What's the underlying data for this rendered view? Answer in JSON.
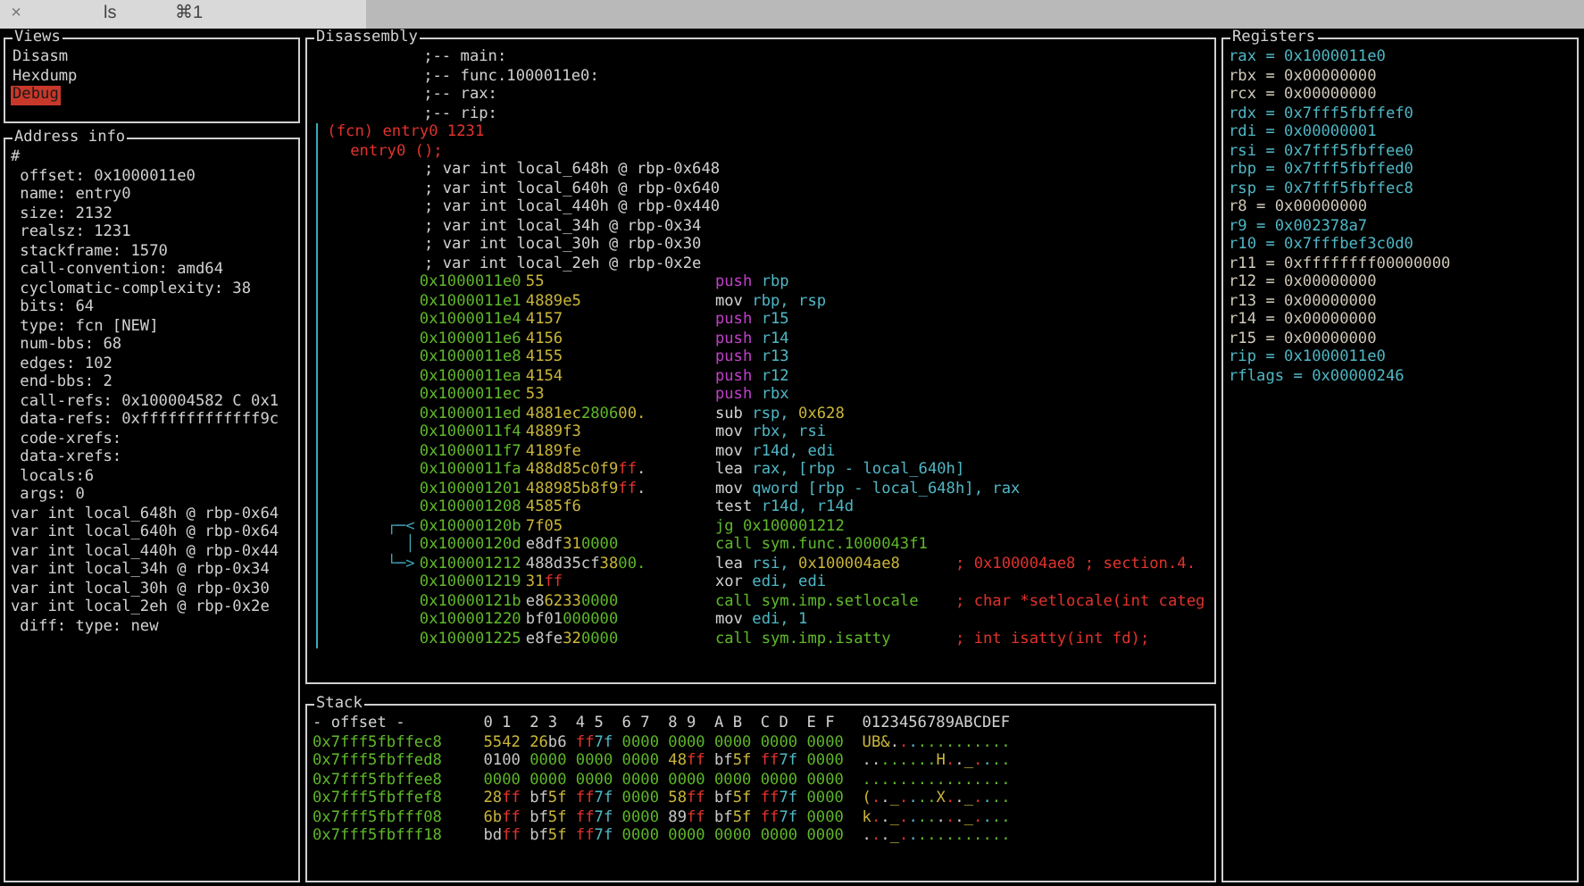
{
  "tab": {
    "close": "×",
    "title": "ls",
    "shortcut": "⌘1"
  },
  "views": {
    "title": "Views",
    "items": [
      {
        "label": "Disasm",
        "selected": false
      },
      {
        "label": "Hexdump",
        "selected": false
      },
      {
        "label": "Debug",
        "selected": true
      }
    ]
  },
  "address_info": {
    "title": "Address info",
    "lines": [
      {
        "text": "#",
        "indented": false
      },
      {
        "text": "offset: 0x1000011e0",
        "indented": true
      },
      {
        "text": "name: entry0",
        "indented": true
      },
      {
        "text": "size: 2132",
        "indented": true
      },
      {
        "text": "realsz: 1231",
        "indented": true
      },
      {
        "text": "stackframe: 1570",
        "indented": true
      },
      {
        "text": "call-convention: amd64",
        "indented": true
      },
      {
        "text": "cyclomatic-complexity: 38",
        "indented": true
      },
      {
        "text": "bits: 64",
        "indented": true
      },
      {
        "text": "type: fcn [NEW]",
        "indented": true
      },
      {
        "text": "num-bbs: 68",
        "indented": true
      },
      {
        "text": "edges: 102",
        "indented": true
      },
      {
        "text": "end-bbs: 2",
        "indented": true
      },
      {
        "text": "call-refs: 0x100004582 C 0x1",
        "indented": true
      },
      {
        "text": "data-refs: 0xfffffffffffff9c",
        "indented": true
      },
      {
        "text": "code-xrefs:",
        "indented": true
      },
      {
        "text": "data-xrefs:",
        "indented": true
      },
      {
        "text": "locals:6",
        "indented": true
      },
      {
        "text": "args: 0",
        "indented": true
      },
      {
        "text": "var int local_648h @ rbp-0x64",
        "indented": false
      },
      {
        "text": "var int local_640h @ rbp-0x64",
        "indented": false
      },
      {
        "text": "var int local_440h @ rbp-0x44",
        "indented": false
      },
      {
        "text": "var int local_34h @ rbp-0x34",
        "indented": false
      },
      {
        "text": "var int local_30h @ rbp-0x30",
        "indented": false
      },
      {
        "text": "var int local_2eh @ rbp-0x2e",
        "indented": false
      },
      {
        "text": "diff: type: new",
        "indented": true
      }
    ]
  },
  "disassembly": {
    "title": "Disassembly",
    "flags": [
      ";-- main:",
      ";-- func.1000011e0:",
      ";-- rax:",
      ";-- rip:"
    ],
    "function_header": "(fcn) entry0 1231",
    "function_signature": "entry0 ();",
    "vars": [
      "; var int local_648h @ rbp-0x648",
      "; var int local_640h @ rbp-0x640",
      "; var int local_440h @ rbp-0x440",
      "; var int local_34h @ rbp-0x34",
      "; var int local_30h @ rbp-0x30",
      "; var int local_2eh @ rbp-0x2e"
    ],
    "instructions": [
      {
        "address": "0x1000011e0",
        "bytes": [
          {
            "text": "55",
            "kind": "printable"
          }
        ],
        "mnemonic": "push",
        "kind": "stack",
        "operands": [
          {
            "text": "rbp",
            "kind": "reg"
          }
        ]
      },
      {
        "address": "0x1000011e1",
        "bytes": [
          {
            "text": "4889e5",
            "kind": "printable"
          }
        ],
        "mnemonic": "mov",
        "kind": "data",
        "operands": [
          {
            "text": "rbp, rsp",
            "kind": "reg"
          }
        ]
      },
      {
        "address": "0x1000011e4",
        "bytes": [
          {
            "text": "4157",
            "kind": "printable"
          }
        ],
        "mnemonic": "push",
        "kind": "stack",
        "operands": [
          {
            "text": "r15",
            "kind": "reg"
          }
        ]
      },
      {
        "address": "0x1000011e6",
        "bytes": [
          {
            "text": "4156",
            "kind": "printable"
          }
        ],
        "mnemonic": "push",
        "kind": "stack",
        "operands": [
          {
            "text": "r14",
            "kind": "reg"
          }
        ]
      },
      {
        "address": "0x1000011e8",
        "bytes": [
          {
            "text": "4155",
            "kind": "printable"
          }
        ],
        "mnemonic": "push",
        "kind": "stack",
        "operands": [
          {
            "text": "r13",
            "kind": "reg"
          }
        ]
      },
      {
        "address": "0x1000011ea",
        "bytes": [
          {
            "text": "4154",
            "kind": "printable"
          }
        ],
        "mnemonic": "push",
        "kind": "stack",
        "operands": [
          {
            "text": "r12",
            "kind": "reg"
          }
        ]
      },
      {
        "address": "0x1000011ec",
        "bytes": [
          {
            "text": "53",
            "kind": "printable"
          }
        ],
        "mnemonic": "push",
        "kind": "stack",
        "operands": [
          {
            "text": "rbx",
            "kind": "reg"
          }
        ]
      },
      {
        "address": "0x1000011ed",
        "bytes": [
          {
            "text": "4881ec",
            "kind": "printable"
          },
          {
            "text": "2806",
            "kind": "zero"
          },
          {
            "text": "00.",
            "kind": "printable"
          }
        ],
        "mnemonic": "sub",
        "kind": "data",
        "operands": [
          {
            "text": "rsp, ",
            "kind": "reg"
          },
          {
            "text": "0x628",
            "kind": "imm"
          }
        ]
      },
      {
        "address": "0x1000011f4",
        "bytes": [
          {
            "text": "4889f3",
            "kind": "printable"
          }
        ],
        "mnemonic": "mov",
        "kind": "data",
        "operands": [
          {
            "text": "rbx, rsi",
            "kind": "reg"
          }
        ]
      },
      {
        "address": "0x1000011f7",
        "bytes": [
          {
            "text": "4189fe",
            "kind": "printable"
          }
        ],
        "mnemonic": "mov",
        "kind": "data",
        "operands": [
          {
            "text": "r14d, edi",
            "kind": "reg"
          }
        ]
      },
      {
        "address": "0x1000011fa",
        "bytes": [
          {
            "text": "488d85c0f9",
            "kind": "printable"
          },
          {
            "text": "ff",
            "kind": "ff"
          },
          {
            "text": ".",
            "kind": "other"
          }
        ],
        "mnemonic": "lea",
        "kind": "data",
        "operands": [
          {
            "text": "rax, [rbp - local_640h]",
            "kind": "reg"
          }
        ]
      },
      {
        "address": "0x100001201",
        "bytes": [
          {
            "text": "488985b8f9",
            "kind": "printable"
          },
          {
            "text": "ff",
            "kind": "ff"
          },
          {
            "text": ".",
            "kind": "other"
          }
        ],
        "mnemonic": "mov",
        "kind": "data",
        "operands": [
          {
            "text": "qword [rbp - local_648h], rax",
            "kind": "reg"
          }
        ]
      },
      {
        "address": "0x100001208",
        "bytes": [
          {
            "text": "4585f6",
            "kind": "printable"
          }
        ],
        "mnemonic": "test",
        "kind": "data",
        "operands": [
          {
            "text": "r14d, r14d",
            "kind": "reg"
          }
        ]
      },
      {
        "address": "0x10000120b",
        "jump": "┌─<",
        "bytes": [
          {
            "text": "7f05",
            "kind": "printable"
          }
        ],
        "mnemonic": "jg",
        "kind": "flow",
        "operands": [
          {
            "text": "0x100001212",
            "kind": "target"
          }
        ]
      },
      {
        "address": "0x10000120d",
        "jump": "│",
        "bytes": [
          {
            "text": "e8df",
            "kind": "other"
          },
          {
            "text": "31",
            "kind": "printable"
          },
          {
            "text": "0000",
            "kind": "zero"
          }
        ],
        "mnemonic": "call",
        "kind": "flow",
        "operands": [
          {
            "text": "sym.func.1000043f1",
            "kind": "target"
          }
        ]
      },
      {
        "address": "0x100001212",
        "jump": "└─>",
        "bytes": [
          {
            "text": "488d35cf",
            "kind": "other"
          },
          {
            "text": "38",
            "kind": "printable"
          },
          {
            "text": "00.",
            "kind": "zero"
          }
        ],
        "mnemonic": "lea",
        "kind": "data",
        "operands": [
          {
            "text": "rsi, ",
            "kind": "reg"
          },
          {
            "text": "0x100004ae8",
            "kind": "imm"
          }
        ],
        "comment": "; 0x100004ae8 ; section.4."
      },
      {
        "address": "0x100001219",
        "bytes": [
          {
            "text": "31",
            "kind": "printable"
          },
          {
            "text": "ff",
            "kind": "ff"
          }
        ],
        "mnemonic": "xor",
        "kind": "data",
        "operands": [
          {
            "text": "edi, edi",
            "kind": "reg"
          }
        ]
      },
      {
        "address": "0x10000121b",
        "bytes": [
          {
            "text": "e8",
            "kind": "other"
          },
          {
            "text": "6233",
            "kind": "printable"
          },
          {
            "text": "0000",
            "kind": "zero"
          }
        ],
        "mnemonic": "call",
        "kind": "flow",
        "operands": [
          {
            "text": "sym.imp.setlocale",
            "kind": "target"
          }
        ],
        "comment": "; char *setlocale(int categ"
      },
      {
        "address": "0x100001220",
        "bytes": [
          {
            "text": "bf01",
            "kind": "other"
          },
          {
            "text": "000000",
            "kind": "zero"
          }
        ],
        "mnemonic": "mov",
        "kind": "data",
        "operands": [
          {
            "text": "edi, 1",
            "kind": "reg"
          }
        ]
      },
      {
        "address": "0x100001225",
        "bytes": [
          {
            "text": "e8fe",
            "kind": "other"
          },
          {
            "text": "32",
            "kind": "printable"
          },
          {
            "text": "0000",
            "kind": "zero"
          }
        ],
        "mnemonic": "call",
        "kind": "flow",
        "operands": [
          {
            "text": "sym.imp.isatty",
            "kind": "target"
          }
        ],
        "comment": "; int isatty(int fd);"
      }
    ]
  },
  "stack": {
    "title": "Stack",
    "offset_header": "- offset -",
    "column_headers": [
      "0 1",
      "2 3",
      "4 5",
      "6 7",
      "8 9",
      "A B",
      "C D",
      "E F"
    ],
    "ascii_header": "0123456789ABCDEF",
    "rows": [
      {
        "offset": "0x7fff5fbffec8",
        "bytes": [
          {
            "text": "55",
            "kind": "printable"
          },
          {
            "text": "42",
            "kind": "printable"
          },
          {
            "text": "26",
            "kind": "printable"
          },
          {
            "text": "b6",
            "kind": "other"
          },
          {
            "text": "ff",
            "kind": "ff"
          },
          {
            "text": "7f",
            "kind": "del"
          },
          {
            "text": "00",
            "kind": "zero"
          },
          {
            "text": "00",
            "kind": "zero"
          },
          {
            "text": "00",
            "kind": "zero"
          },
          {
            "text": "00",
            "kind": "zero"
          },
          {
            "text": "00",
            "kind": "zero"
          },
          {
            "text": "00",
            "kind": "zero"
          },
          {
            "text": "00",
            "kind": "zero"
          },
          {
            "text": "00",
            "kind": "zero"
          },
          {
            "text": "00",
            "kind": "zero"
          },
          {
            "text": "00",
            "kind": "zero"
          }
        ],
        "ascii": "UB&............."
      },
      {
        "offset": "0x7fff5fbffed8",
        "bytes": [
          {
            "text": "01",
            "kind": "other"
          },
          {
            "text": "00",
            "kind": "other"
          },
          {
            "text": "00",
            "kind": "zero"
          },
          {
            "text": "00",
            "kind": "zero"
          },
          {
            "text": "00",
            "kind": "zero"
          },
          {
            "text": "00",
            "kind": "zero"
          },
          {
            "text": "00",
            "kind": "zero"
          },
          {
            "text": "00",
            "kind": "zero"
          },
          {
            "text": "48",
            "kind": "printable"
          },
          {
            "text": "ff",
            "kind": "ff"
          },
          {
            "text": "bf",
            "kind": "other"
          },
          {
            "text": "5f",
            "kind": "printable"
          },
          {
            "text": "ff",
            "kind": "ff"
          },
          {
            "text": "7f",
            "kind": "del"
          },
          {
            "text": "00",
            "kind": "zero"
          },
          {
            "text": "00",
            "kind": "zero"
          }
        ],
        "ascii": "........H.._...."
      },
      {
        "offset": "0x7fff5fbffee8",
        "bytes": [
          {
            "text": "00",
            "kind": "zero"
          },
          {
            "text": "00",
            "kind": "zero"
          },
          {
            "text": "00",
            "kind": "zero"
          },
          {
            "text": "00",
            "kind": "zero"
          },
          {
            "text": "00",
            "kind": "zero"
          },
          {
            "text": "00",
            "kind": "zero"
          },
          {
            "text": "00",
            "kind": "zero"
          },
          {
            "text": "00",
            "kind": "zero"
          },
          {
            "text": "00",
            "kind": "zero"
          },
          {
            "text": "00",
            "kind": "zero"
          },
          {
            "text": "00",
            "kind": "zero"
          },
          {
            "text": "00",
            "kind": "zero"
          },
          {
            "text": "00",
            "kind": "zero"
          },
          {
            "text": "00",
            "kind": "zero"
          },
          {
            "text": "00",
            "kind": "zero"
          },
          {
            "text": "00",
            "kind": "zero"
          }
        ],
        "ascii": "................"
      },
      {
        "offset": "0x7fff5fbffef8",
        "bytes": [
          {
            "text": "28",
            "kind": "printable"
          },
          {
            "text": "ff",
            "kind": "ff"
          },
          {
            "text": "bf",
            "kind": "other"
          },
          {
            "text": "5f",
            "kind": "printable"
          },
          {
            "text": "ff",
            "kind": "ff"
          },
          {
            "text": "7f",
            "kind": "del"
          },
          {
            "text": "00",
            "kind": "zero"
          },
          {
            "text": "00",
            "kind": "zero"
          },
          {
            "text": "58",
            "kind": "printable"
          },
          {
            "text": "ff",
            "kind": "ff"
          },
          {
            "text": "bf",
            "kind": "other"
          },
          {
            "text": "5f",
            "kind": "printable"
          },
          {
            "text": "ff",
            "kind": "ff"
          },
          {
            "text": "7f",
            "kind": "del"
          },
          {
            "text": "00",
            "kind": "zero"
          },
          {
            "text": "00",
            "kind": "zero"
          }
        ],
        "ascii": "(.._....X.._...."
      },
      {
        "offset": "0x7fff5fbfff08",
        "bytes": [
          {
            "text": "6b",
            "kind": "printable"
          },
          {
            "text": "ff",
            "kind": "ff"
          },
          {
            "text": "bf",
            "kind": "other"
          },
          {
            "text": "5f",
            "kind": "printable"
          },
          {
            "text": "ff",
            "kind": "ff"
          },
          {
            "text": "7f",
            "kind": "del"
          },
          {
            "text": "00",
            "kind": "zero"
          },
          {
            "text": "00",
            "kind": "zero"
          },
          {
            "text": "89",
            "kind": "other"
          },
          {
            "text": "ff",
            "kind": "ff"
          },
          {
            "text": "bf",
            "kind": "other"
          },
          {
            "text": "5f",
            "kind": "printable"
          },
          {
            "text": "ff",
            "kind": "ff"
          },
          {
            "text": "7f",
            "kind": "del"
          },
          {
            "text": "00",
            "kind": "zero"
          },
          {
            "text": "00",
            "kind": "zero"
          }
        ],
        "ascii": "k.._......._...."
      },
      {
        "offset": "0x7fff5fbfff18",
        "bytes": [
          {
            "text": "bd",
            "kind": "other"
          },
          {
            "text": "ff",
            "kind": "ff"
          },
          {
            "text": "bf",
            "kind": "other"
          },
          {
            "text": "5f",
            "kind": "printable"
          },
          {
            "text": "ff",
            "kind": "ff"
          },
          {
            "text": "7f",
            "kind": "del"
          },
          {
            "text": "00",
            "kind": "zero"
          },
          {
            "text": "00",
            "kind": "zero"
          },
          {
            "text": "00",
            "kind": "zero"
          },
          {
            "text": "00",
            "kind": "zero"
          },
          {
            "text": "00",
            "kind": "zero"
          },
          {
            "text": "00",
            "kind": "zero"
          },
          {
            "text": "00",
            "kind": "zero"
          },
          {
            "text": "00",
            "kind": "zero"
          },
          {
            "text": "00",
            "kind": "zero"
          },
          {
            "text": "00",
            "kind": "zero"
          }
        ],
        "ascii": "..._............"
      }
    ]
  },
  "registers": {
    "title": "Registers",
    "items": [
      {
        "text": "rax = 0x1000011e0",
        "highlight": true
      },
      {
        "text": "rbx = 0x00000000",
        "highlight": false
      },
      {
        "text": "rcx = 0x00000000",
        "highlight": false
      },
      {
        "text": "rdx = 0x7fff5fbffef0",
        "highlight": true
      },
      {
        "text": "rdi = 0x00000001",
        "highlight": true
      },
      {
        "text": "rsi = 0x7fff5fbffee0",
        "highlight": true
      },
      {
        "text": "rbp = 0x7fff5fbffed0",
        "highlight": true
      },
      {
        "text": "rsp = 0x7fff5fbffec8",
        "highlight": true
      },
      {
        "text": "r8 = 0x00000000",
        "highlight": false
      },
      {
        "text": "r9 = 0x002378a7",
        "highlight": true
      },
      {
        "text": "r10 = 0x7fffbef3c0d0",
        "highlight": true
      },
      {
        "text": "r11 = 0xffffffff00000000",
        "highlight": false
      },
      {
        "text": "r12 = 0x00000000",
        "highlight": false
      },
      {
        "text": "r13 = 0x00000000",
        "highlight": false
      },
      {
        "text": "r14 = 0x00000000",
        "highlight": false
      },
      {
        "text": "r15 = 0x00000000",
        "highlight": false
      },
      {
        "text": "rip = 0x1000011e0",
        "highlight": true
      },
      {
        "text": "rflags = 0x00000246",
        "highlight": true
      }
    ]
  }
}
